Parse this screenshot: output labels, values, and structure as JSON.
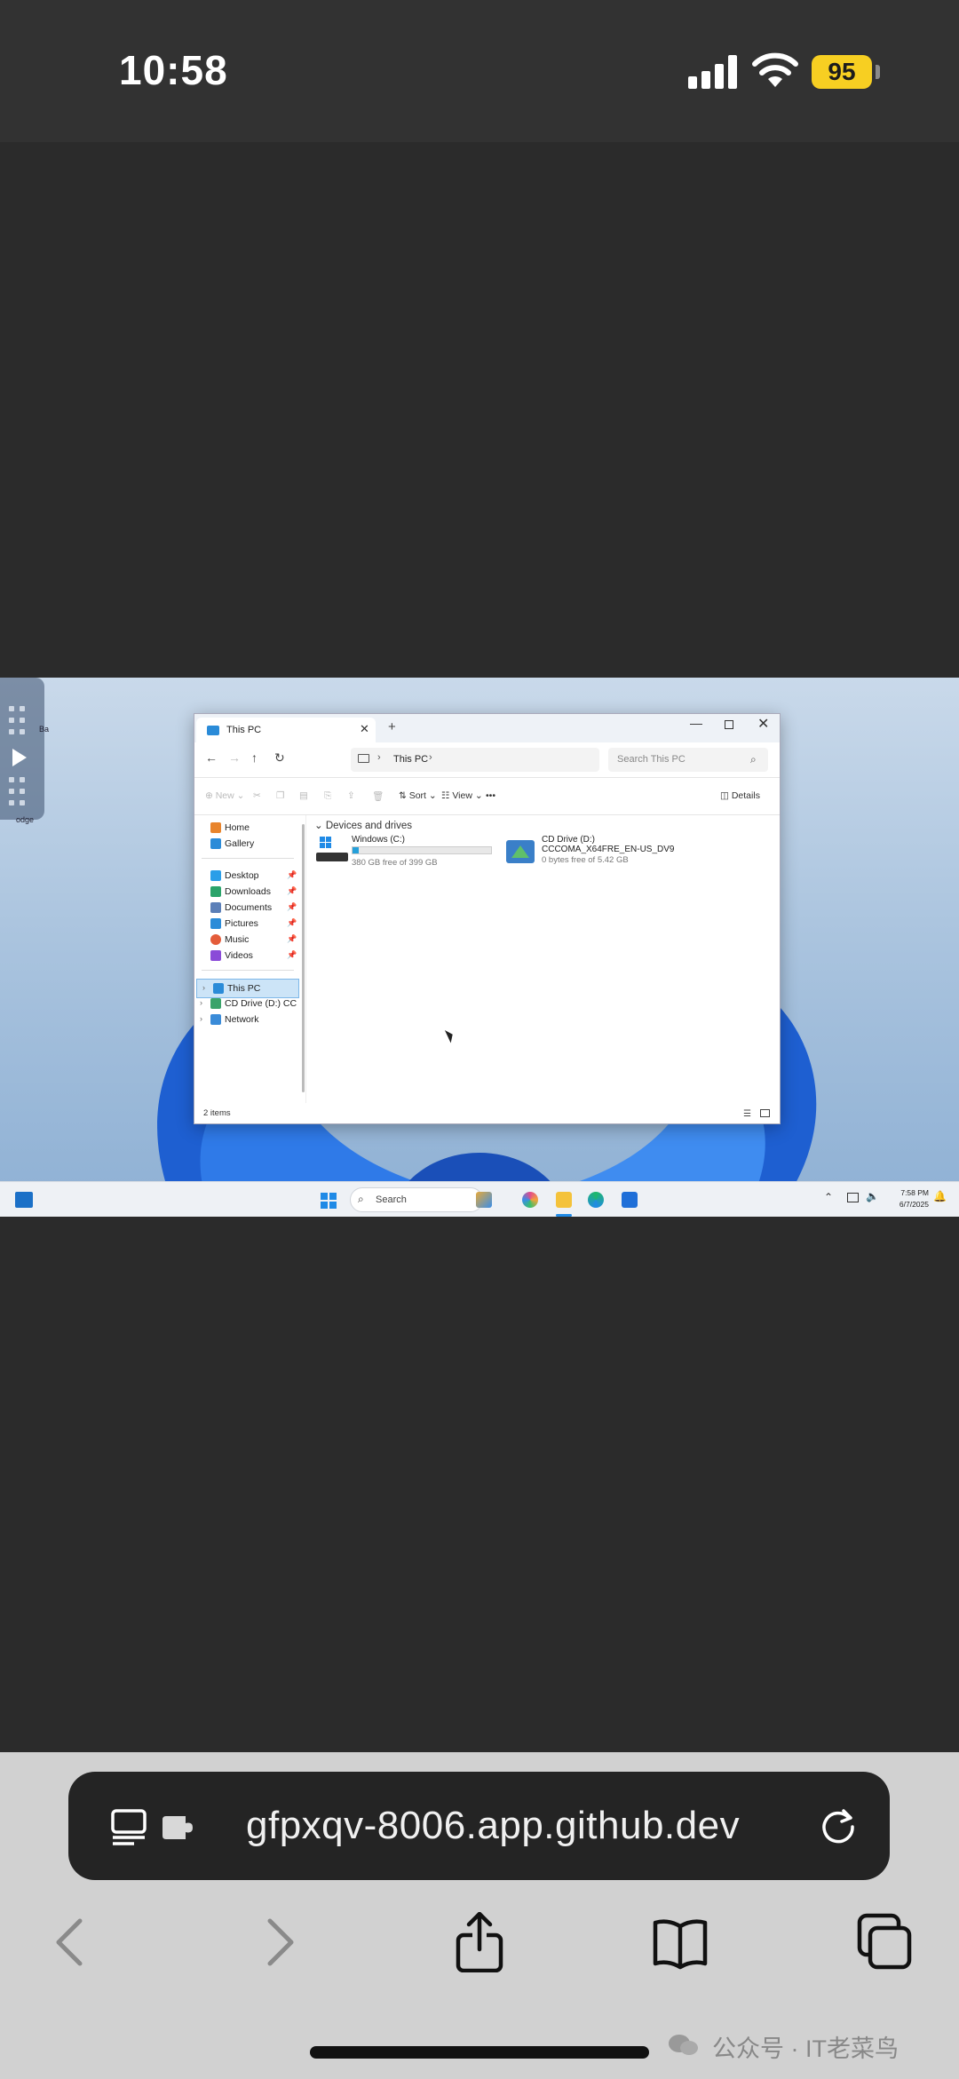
{
  "status_bar": {
    "time": "10:58",
    "battery": "95",
    "battery_color": "#f7cf22"
  },
  "remote_desktop": {
    "desktop_labels": [
      "Ba",
      "odge"
    ],
    "explorer": {
      "tab_title": "This PC",
      "address": {
        "location": "This PC"
      },
      "search_placeholder": "Search This PC",
      "toolbar": {
        "new": "New",
        "sort": "Sort",
        "view": "View",
        "more": "•••",
        "details": "Details"
      },
      "sidebar": {
        "quick": [
          {
            "label": "Home",
            "icon": "home-icon",
            "color": "#e8842c"
          },
          {
            "label": "Gallery",
            "icon": "gallery-icon",
            "color": "#2a8bd8"
          }
        ],
        "pinned": [
          {
            "label": "Desktop",
            "icon": "desktop-folder-icon",
            "color": "#2a9ee8"
          },
          {
            "label": "Downloads",
            "icon": "download-icon",
            "color": "#2aa36a"
          },
          {
            "label": "Documents",
            "icon": "documents-icon",
            "color": "#5b7fb8"
          },
          {
            "label": "Pictures",
            "icon": "pictures-icon",
            "color": "#2a8bd8"
          },
          {
            "label": "Music",
            "icon": "music-icon",
            "color": "#e45c3a"
          },
          {
            "label": "Videos",
            "icon": "videos-icon",
            "color": "#8a4ad8"
          }
        ],
        "locations": [
          {
            "label": "This PC",
            "icon": "computer-icon",
            "color": "#2a8bd8"
          },
          {
            "label": "CD Drive (D:) CC",
            "icon": "cd-drive-icon",
            "color": "#3aa36a"
          },
          {
            "label": "Network",
            "icon": "network-icon",
            "color": "#3a8bd8"
          }
        ]
      },
      "group_header": "Devices and drives",
      "drives": [
        {
          "name": "Windows (C:)",
          "free": "380 GB free of 399 GB",
          "used_fraction": 0.048
        },
        {
          "name": "CD Drive (D:)",
          "volume": "CCCOMA_X64FRE_EN-US_DV9",
          "free": "0 bytes free of 5.42 GB"
        }
      ],
      "status_count": "2 items"
    },
    "taskbar": {
      "search_label": "Search",
      "time": "7:58 PM",
      "date": "6/7/2025"
    }
  },
  "safari": {
    "url": "gfpxqv-8006.app.github.dev"
  },
  "watermark": "公众号 · IT老菜鸟"
}
